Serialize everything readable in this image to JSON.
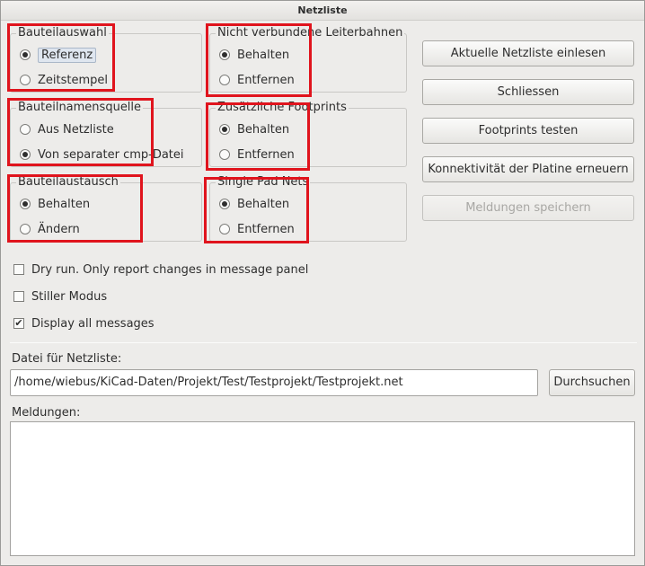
{
  "window": {
    "title": "Netzliste"
  },
  "groups": {
    "bauteilauswahl": {
      "legend": "Bauteilauswahl",
      "options": [
        {
          "label": "Referenz",
          "checked": true
        },
        {
          "label": "Zeitstempel",
          "checked": false
        }
      ]
    },
    "leiterbahnen": {
      "legend": "Nicht verbundene Leiterbahnen",
      "options": [
        {
          "label": "Behalten",
          "checked": true
        },
        {
          "label": "Entfernen",
          "checked": false
        }
      ]
    },
    "namensquelle": {
      "legend": "Bauteilnamensquelle",
      "options": [
        {
          "label": "Aus Netzliste",
          "checked": false
        },
        {
          "label": "Von separater cmp-Datei",
          "checked": true
        }
      ]
    },
    "footprints": {
      "legend": "Zusätzliche Footprints",
      "options": [
        {
          "label": "Behalten",
          "checked": true
        },
        {
          "label": "Entfernen",
          "checked": false
        }
      ]
    },
    "austausch": {
      "legend": "Bauteilaustausch",
      "options": [
        {
          "label": "Behalten",
          "checked": true
        },
        {
          "label": "Ändern",
          "checked": false
        }
      ]
    },
    "singlepad": {
      "legend": "Single Pad Nets",
      "options": [
        {
          "label": "Behalten",
          "checked": true
        },
        {
          "label": "Entfernen",
          "checked": false
        }
      ]
    }
  },
  "buttons": {
    "read": "Aktuelle Netzliste einlesen",
    "close": "Schliessen",
    "test": "Footprints testen",
    "rebuild": "Konnektivität der Platine erneuern",
    "save": "Meldungen speichern"
  },
  "checkboxes": [
    {
      "label": "Dry run. Only report changes in message panel",
      "checked": false
    },
    {
      "label": "Stiller Modus",
      "checked": false
    },
    {
      "label": "Display all messages",
      "checked": true
    }
  ],
  "file": {
    "label": "Datei für Netzliste:",
    "value": "/home/wiebus/KiCad-Daten/Projekt/Test/Testprojekt/Testprojekt.net",
    "browse": "Durchsuchen"
  },
  "messages": {
    "label": "Meldungen:"
  },
  "icons": {
    "checked_mark": "✔"
  },
  "colors": {
    "highlight_border": "#e0141d"
  }
}
